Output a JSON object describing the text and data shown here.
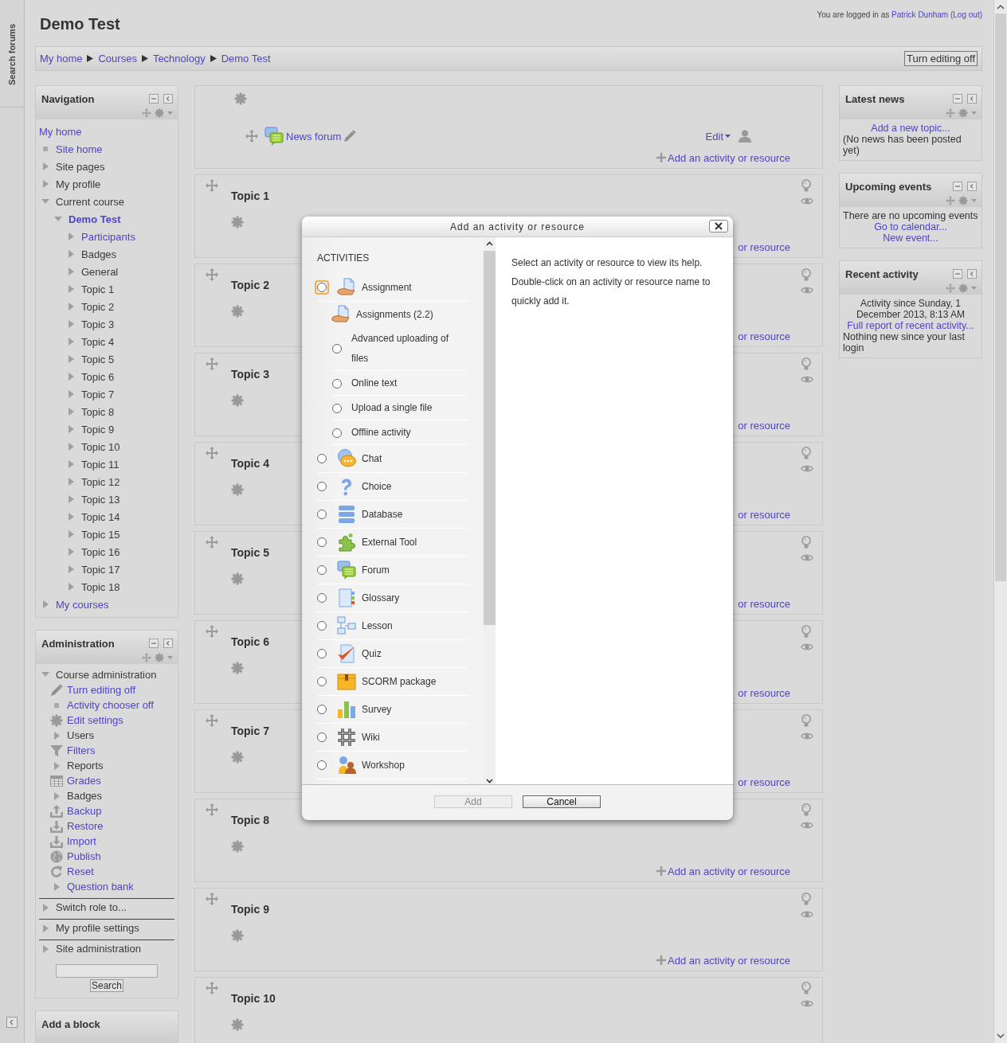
{
  "left_dock": {
    "label": "Search forums"
  },
  "header": {
    "title": "Demo Test",
    "login_text": "You are logged in as",
    "user": "Patrick Dunham",
    "logout": "(Log out)"
  },
  "breadcrumb": {
    "items": [
      "My home",
      "Courses",
      "Technology",
      "Demo Test"
    ],
    "button": "Turn editing off"
  },
  "navigation": {
    "title": "Navigation",
    "tree": [
      {
        "label": "My home",
        "kind": "root",
        "link": true,
        "active": false
      },
      {
        "label": "Site home",
        "kind": "leaf",
        "link": true,
        "active": false
      },
      {
        "label": "Site pages",
        "kind": "branch",
        "expanded": false,
        "link": false,
        "active": false
      },
      {
        "label": "My profile",
        "kind": "branch",
        "expanded": false,
        "link": false,
        "active": false
      },
      {
        "label": "Current course",
        "kind": "branch",
        "expanded": true,
        "link": false,
        "active": false,
        "children": [
          {
            "label": "Demo Test",
            "kind": "branch",
            "expanded": true,
            "link": true,
            "active": true,
            "children": [
              {
                "label": "Participants",
                "kind": "branch",
                "expanded": false,
                "link": true,
                "active": false
              },
              {
                "label": "Badges",
                "kind": "branch",
                "expanded": false,
                "link": false,
                "active": false
              },
              {
                "label": "General",
                "kind": "branch",
                "expanded": false,
                "link": false,
                "active": false
              },
              {
                "label": "Topic 1",
                "kind": "branch",
                "expanded": false,
                "link": false,
                "active": false
              },
              {
                "label": "Topic 2",
                "kind": "branch",
                "expanded": false,
                "link": false,
                "active": false
              },
              {
                "label": "Topic 3",
                "kind": "branch",
                "expanded": false,
                "link": false,
                "active": false
              },
              {
                "label": "Topic 4",
                "kind": "branch",
                "expanded": false,
                "link": false,
                "active": false
              },
              {
                "label": "Topic 5",
                "kind": "branch",
                "expanded": false,
                "link": false,
                "active": false
              },
              {
                "label": "Topic 6",
                "kind": "branch",
                "expanded": false,
                "link": false,
                "active": false
              },
              {
                "label": "Topic 7",
                "kind": "branch",
                "expanded": false,
                "link": false,
                "active": false
              },
              {
                "label": "Topic 8",
                "kind": "branch",
                "expanded": false,
                "link": false,
                "active": false
              },
              {
                "label": "Topic 9",
                "kind": "branch",
                "expanded": false,
                "link": false,
                "active": false
              },
              {
                "label": "Topic 10",
                "kind": "branch",
                "expanded": false,
                "link": false,
                "active": false
              },
              {
                "label": "Topic 11",
                "kind": "branch",
                "expanded": false,
                "link": false,
                "active": false
              },
              {
                "label": "Topic 12",
                "kind": "branch",
                "expanded": false,
                "link": false,
                "active": false
              },
              {
                "label": "Topic 13",
                "kind": "branch",
                "expanded": false,
                "link": false,
                "active": false
              },
              {
                "label": "Topic 14",
                "kind": "branch",
                "expanded": false,
                "link": false,
                "active": false
              },
              {
                "label": "Topic 15",
                "kind": "branch",
                "expanded": false,
                "link": false,
                "active": false
              },
              {
                "label": "Topic 16",
                "kind": "branch",
                "expanded": false,
                "link": false,
                "active": false
              },
              {
                "label": "Topic 17",
                "kind": "branch",
                "expanded": false,
                "link": false,
                "active": false
              },
              {
                "label": "Topic 18",
                "kind": "branch",
                "expanded": false,
                "link": false,
                "active": false
              }
            ]
          }
        ]
      },
      {
        "label": "My courses",
        "kind": "branch",
        "expanded": false,
        "link": true,
        "active": false
      }
    ]
  },
  "administration": {
    "title": "Administration",
    "tree": [
      {
        "label": "Course administration",
        "kind": "branch",
        "expanded": true,
        "link": false,
        "children": [
          {
            "label": "Turn editing off",
            "kind": "pencil",
            "link": true
          },
          {
            "label": "Activity chooser off",
            "kind": "leaf",
            "link": true
          },
          {
            "label": "Edit settings",
            "kind": "gear",
            "link": true
          },
          {
            "label": "Users",
            "kind": "branch",
            "expanded": false,
            "link": false
          },
          {
            "label": "Filters",
            "kind": "filter",
            "link": true
          },
          {
            "label": "Reports",
            "kind": "branch",
            "expanded": false,
            "link": false
          },
          {
            "label": "Grades",
            "kind": "grades",
            "link": true
          },
          {
            "label": "Badges",
            "kind": "branch",
            "expanded": false,
            "link": false
          },
          {
            "label": "Backup",
            "kind": "backup",
            "link": true
          },
          {
            "label": "Restore",
            "kind": "restore",
            "link": true
          },
          {
            "label": "Import",
            "kind": "restore",
            "link": true
          },
          {
            "label": "Publish",
            "kind": "publish",
            "link": true
          },
          {
            "label": "Reset",
            "kind": "reset",
            "link": true
          },
          {
            "label": "Question bank",
            "kind": "branch",
            "expanded": false,
            "link": true
          }
        ]
      },
      {
        "label": "Switch role to...",
        "kind": "branch",
        "expanded": false,
        "link": false
      },
      {
        "label": "My profile settings",
        "kind": "branch",
        "expanded": false,
        "link": false
      },
      {
        "label": "Site administration",
        "kind": "branch",
        "expanded": false,
        "link": false
      }
    ],
    "search_button": "Search"
  },
  "add_block": {
    "title": "Add a block"
  },
  "sections": [
    {
      "kind": "general",
      "activities": [
        {
          "label": "News forum",
          "kind": "forum",
          "menu": "Edit"
        }
      ],
      "add_link": {
        "label": "Add an activity or resource",
        "icon": true
      }
    },
    {
      "kind": "topic",
      "title": "Topic 1",
      "add_link": {
        "label": "or resource",
        "icon": false
      }
    },
    {
      "kind": "topic",
      "title": "Topic 2",
      "add_link": {
        "label": "or resource",
        "icon": false
      }
    },
    {
      "kind": "topic",
      "title": "Topic 3",
      "add_link": {
        "label": "or resource",
        "icon": false
      }
    },
    {
      "kind": "topic",
      "title": "Topic 4",
      "add_link": {
        "label": "or resource",
        "icon": false
      }
    },
    {
      "kind": "topic",
      "title": "Topic 5",
      "add_link": {
        "label": "or resource",
        "icon": false
      }
    },
    {
      "kind": "topic",
      "title": "Topic 6",
      "add_link": {
        "label": "or resource",
        "icon": false
      }
    },
    {
      "kind": "topic",
      "title": "Topic 7",
      "add_link": {
        "label": "or resource",
        "icon": false
      }
    },
    {
      "kind": "topic",
      "title": "Topic 8",
      "add_link": {
        "label": "Add an activity or resource",
        "icon": true
      }
    },
    {
      "kind": "topic",
      "title": "Topic 9",
      "add_link": {
        "label": "Add an activity or resource",
        "icon": true
      }
    },
    {
      "kind": "topic",
      "title": "Topic 10"
    }
  ],
  "right_blocks": [
    {
      "title": "Latest news",
      "content": [
        {
          "kind": "link",
          "text": "Add a new topic..."
        },
        {
          "kind": "text",
          "text": "(No news has been posted yet)"
        }
      ]
    },
    {
      "title": "Upcoming events",
      "content": [
        {
          "kind": "text",
          "text": "There are no upcoming events"
        },
        {
          "kind": "link",
          "text": "Go to calendar..."
        },
        {
          "kind": "link",
          "text": "New event..."
        }
      ]
    },
    {
      "title": "Recent activity",
      "content": [
        {
          "kind": "note",
          "text": "Activity since Sunday, 1 December 2013, 8:13 AM"
        },
        {
          "kind": "link",
          "text": "Full report of recent activity..."
        },
        {
          "kind": "text",
          "text": "Nothing new since your last login"
        }
      ]
    }
  ],
  "dialog": {
    "title": "Add an activity or resource",
    "section_label": "ACTIVITIES",
    "items": [
      {
        "label": "Assignment",
        "kind": "assignment",
        "checked": false,
        "focused": true
      },
      {
        "label": "Assignments (2.2)",
        "kind": "assignment",
        "children": [
          {
            "label": "Advanced uploading of files",
            "checked": false,
            "focused": false
          },
          {
            "label": "Online text",
            "checked": false,
            "focused": false
          },
          {
            "label": "Upload a single file",
            "checked": false,
            "focused": false
          },
          {
            "label": "Offline activity",
            "checked": false,
            "focused": false
          }
        ]
      },
      {
        "label": "Chat",
        "kind": "chat",
        "checked": false,
        "focused": false
      },
      {
        "label": "Choice",
        "kind": "choice",
        "checked": false,
        "focused": false
      },
      {
        "label": "Database",
        "kind": "database",
        "checked": false,
        "focused": false
      },
      {
        "label": "External Tool",
        "kind": "lti",
        "checked": false,
        "focused": false
      },
      {
        "label": "Forum",
        "kind": "forum",
        "checked": false,
        "focused": false
      },
      {
        "label": "Glossary",
        "kind": "glossary",
        "checked": false,
        "focused": false
      },
      {
        "label": "Lesson",
        "kind": "lesson",
        "checked": false,
        "focused": false
      },
      {
        "label": "Quiz",
        "kind": "quiz",
        "checked": false,
        "focused": false
      },
      {
        "label": "SCORM package",
        "kind": "scorm",
        "checked": false,
        "focused": false
      },
      {
        "label": "Survey",
        "kind": "survey",
        "checked": false,
        "focused": false
      },
      {
        "label": "Wiki",
        "kind": "wiki",
        "checked": false,
        "focused": false
      },
      {
        "label": "Workshop",
        "kind": "workshop",
        "checked": false,
        "focused": false
      }
    ],
    "help": [
      "Select an activity or resource to view its help.",
      "Double-click on an activity or resource name to quickly add it."
    ],
    "buttons": [
      {
        "label": "Add",
        "disabled": true
      },
      {
        "label": "Cancel",
        "disabled": false
      }
    ]
  }
}
